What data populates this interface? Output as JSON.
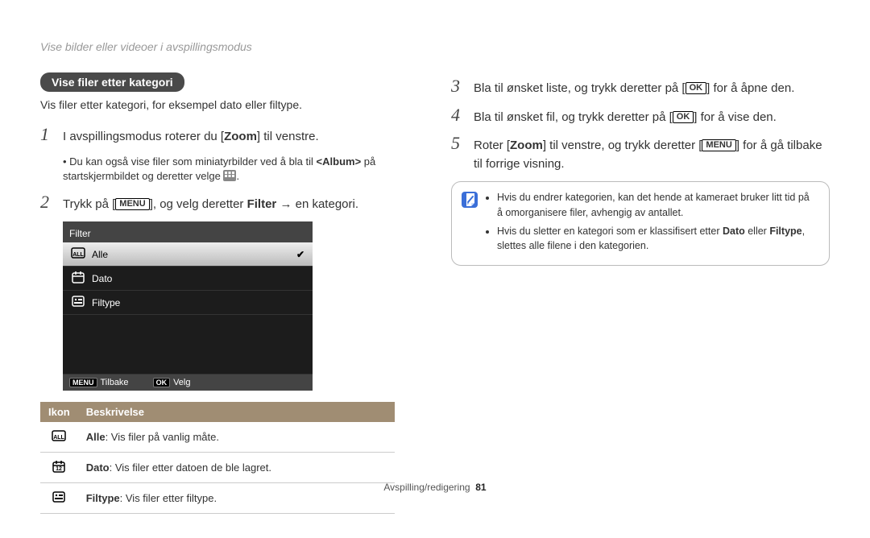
{
  "breadcrumb": "Vise bilder eller videoer i avspillingsmodus",
  "section_title": "Vise filer etter kategori",
  "section_intro": "Vis filer etter kategori, for eksempel dato eller filtype.",
  "keys": {
    "menu": "MENU",
    "ok": "OK"
  },
  "steps_left": [
    {
      "num": "1",
      "text_before": "I avspillingsmodus roterer du [",
      "bold1": "Zoom",
      "text_after": "] til venstre.",
      "sub": {
        "pre": "Du kan også vise filer som miniatyrbilder ved å bla til ",
        "bold": "<Album>",
        "mid": " på startskjermbildet og deretter velge ",
        "post": "."
      }
    },
    {
      "num": "2",
      "text_before": "Trykk på [",
      "key": "MENU",
      "text_mid": "], og velg deretter ",
      "bold1": "Filter",
      "text_after": " → en kategori."
    }
  ],
  "steps_right": [
    {
      "num": "3",
      "text_before": "Bla til ønsket liste, og trykk deretter på [",
      "key": "OK",
      "text_after": "] for å åpne den."
    },
    {
      "num": "4",
      "text_before": "Bla til ønsket fil, og trykk deretter på [",
      "key": "OK",
      "text_after": "] for å vise den."
    },
    {
      "num": "5",
      "text_before": "Roter [",
      "bold1": "Zoom",
      "text_mid": "] til venstre, og trykk deretter [",
      "key": "MENU",
      "text_after": "] for å gå tilbake til forrige visning."
    }
  ],
  "screen": {
    "title": "Filter",
    "rows": [
      {
        "label": "Alle",
        "selected": true,
        "icon": "all"
      },
      {
        "label": "Dato",
        "selected": false,
        "icon": "date"
      },
      {
        "label": "Filtype",
        "selected": false,
        "icon": "filetype"
      }
    ],
    "footer": {
      "back_key": "MENU",
      "back_label": "Tilbake",
      "sel_key": "OK",
      "sel_label": "Velg"
    }
  },
  "table": {
    "head_icon": "Ikon",
    "head_desc": "Beskrivelse",
    "rows": [
      {
        "icon": "all",
        "bold": "Alle",
        "rest": ": Vis filer på vanlig måte."
      },
      {
        "icon": "date",
        "bold": "Dato",
        "rest": ": Vis filer etter datoen de ble lagret."
      },
      {
        "icon": "filetype",
        "bold": "Filtype",
        "rest": ": Vis filer etter filtype."
      }
    ]
  },
  "note": {
    "items": [
      {
        "pre": "Hvis du endrer kategorien, kan det hende at kameraet bruker litt tid på å omorganisere filer, avhengig av antallet."
      },
      {
        "pre": "Hvis du sletter en kategori som er klassifisert etter ",
        "b1": "Dato",
        "mid": " eller ",
        "b2": "Filtype",
        "post": ", slettes alle filene i den kategorien."
      }
    ]
  },
  "footer": {
    "section": "Avspilling/redigering",
    "page": "81"
  }
}
